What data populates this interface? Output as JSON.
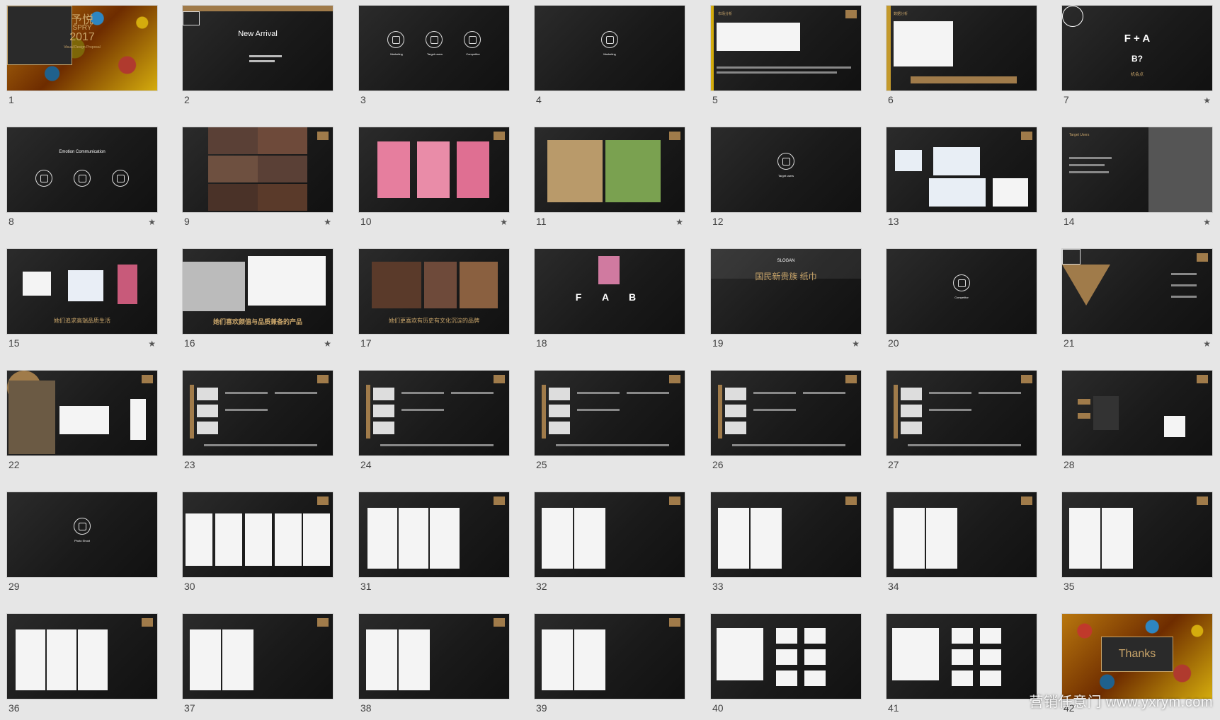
{
  "slides": [
    {
      "num": "1",
      "star": false,
      "type": "cover",
      "lines": [
        "予悦",
        "SPRY",
        "2017",
        "Visual Design Proposal"
      ]
    },
    {
      "num": "2",
      "star": false,
      "type": "arrival",
      "lines": [
        "New Arrival"
      ]
    },
    {
      "num": "3",
      "star": false,
      "type": "icons3",
      "lines": [
        "Marketing",
        "Target users",
        "Competitor"
      ]
    },
    {
      "num": "4",
      "star": false,
      "type": "icon1",
      "lines": [
        "Marketing"
      ]
    },
    {
      "num": "5",
      "star": false,
      "type": "charts",
      "lines": [
        "市场分析"
      ]
    },
    {
      "num": "6",
      "star": false,
      "type": "barchart",
      "lines": [
        "数据分析"
      ]
    },
    {
      "num": "7",
      "star": true,
      "type": "fa",
      "lines": [
        "F + A",
        "B?",
        "机会点"
      ]
    },
    {
      "num": "8",
      "star": true,
      "type": "icons3",
      "lines": [
        "Emotion Communication"
      ]
    },
    {
      "num": "9",
      "star": true,
      "type": "photos4",
      "lines": []
    },
    {
      "num": "10",
      "star": true,
      "type": "posters",
      "lines": []
    },
    {
      "num": "11",
      "star": true,
      "type": "landscape",
      "lines": []
    },
    {
      "num": "12",
      "star": false,
      "type": "icon1",
      "lines": [
        "Target users"
      ]
    },
    {
      "num": "13",
      "star": false,
      "type": "maps",
      "lines": []
    },
    {
      "num": "14",
      "star": true,
      "type": "target",
      "lines": [
        "Target Users"
      ]
    },
    {
      "num": "15",
      "star": true,
      "type": "brands",
      "lines": [
        "她们追求高端品质生活"
      ]
    },
    {
      "num": "16",
      "star": true,
      "type": "products",
      "lines": [
        "她们喜欢颜值与品质兼备的产品"
      ]
    },
    {
      "num": "17",
      "star": false,
      "type": "culture",
      "lines": [
        "她们更喜欢有历史有文化沉淀的品牌"
      ]
    },
    {
      "num": "18",
      "star": false,
      "type": "fab",
      "lines": [
        "F",
        "A",
        "B"
      ]
    },
    {
      "num": "19",
      "star": true,
      "type": "slogan",
      "lines": [
        "SLOGAN",
        "国民新贵族 纸巾"
      ]
    },
    {
      "num": "20",
      "star": false,
      "type": "icon1",
      "lines": [
        "Competitor"
      ]
    },
    {
      "num": "21",
      "star": true,
      "type": "funnel",
      "lines": []
    },
    {
      "num": "22",
      "star": false,
      "type": "analysis",
      "lines": []
    },
    {
      "num": "23",
      "star": false,
      "type": "compete",
      "lines": []
    },
    {
      "num": "24",
      "star": false,
      "type": "compete",
      "lines": []
    },
    {
      "num": "25",
      "star": false,
      "type": "compete",
      "lines": []
    },
    {
      "num": "26",
      "star": false,
      "type": "compete",
      "lines": []
    },
    {
      "num": "27",
      "star": false,
      "type": "compete",
      "lines": []
    },
    {
      "num": "28",
      "star": false,
      "type": "qr",
      "lines": []
    },
    {
      "num": "29",
      "star": false,
      "type": "icon1",
      "lines": [
        "Photo Shoot"
      ]
    },
    {
      "num": "30",
      "star": false,
      "type": "cards5",
      "lines": []
    },
    {
      "num": "31",
      "star": false,
      "type": "cards3",
      "lines": []
    },
    {
      "num": "32",
      "star": false,
      "type": "cards2",
      "lines": []
    },
    {
      "num": "33",
      "star": false,
      "type": "cards2",
      "lines": []
    },
    {
      "num": "34",
      "star": false,
      "type": "cards2",
      "lines": []
    },
    {
      "num": "35",
      "star": false,
      "type": "cards2",
      "lines": []
    },
    {
      "num": "36",
      "star": false,
      "type": "cards3",
      "lines": []
    },
    {
      "num": "37",
      "star": false,
      "type": "cards2",
      "lines": []
    },
    {
      "num": "38",
      "star": false,
      "type": "cards2",
      "lines": []
    },
    {
      "num": "39",
      "star": false,
      "type": "cards2",
      "lines": []
    },
    {
      "num": "40",
      "star": false,
      "type": "pack",
      "lines": []
    },
    {
      "num": "41",
      "star": false,
      "type": "pack",
      "lines": []
    },
    {
      "num": "42",
      "star": false,
      "type": "thanks",
      "lines": [
        "Thanks"
      ]
    }
  ],
  "watermark": "营销任意门 www.yxrym.com"
}
